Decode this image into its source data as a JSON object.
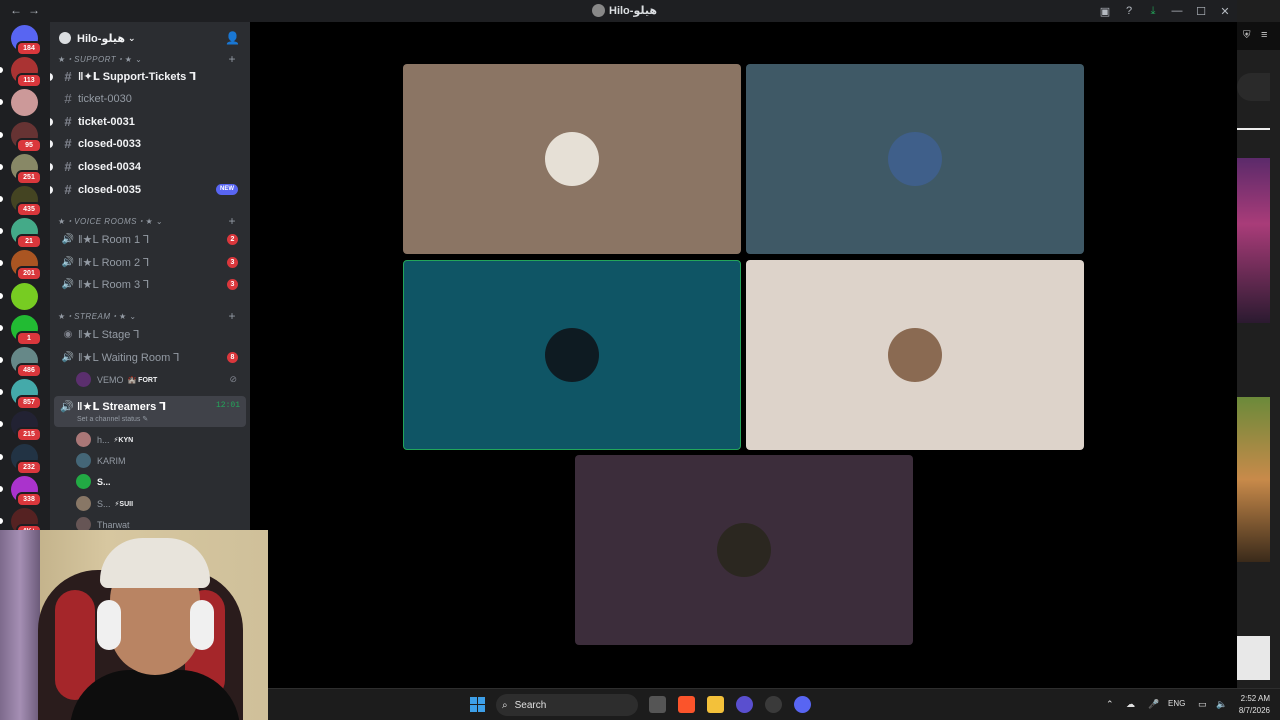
{
  "titlebar": {
    "title": "Hilo-هيلو"
  },
  "guilds": [
    {
      "badge": "184",
      "color": "#5865f2"
    },
    {
      "badge": "113",
      "color": "#a33"
    },
    {
      "badge": "",
      "color": "#c99"
    },
    {
      "badge": "95",
      "color": "#633"
    },
    {
      "badge": "251",
      "color": "#886"
    },
    {
      "badge": "435",
      "color": "#442"
    },
    {
      "badge": "21",
      "color": "#4a8"
    },
    {
      "badge": "201",
      "color": "#a52"
    },
    {
      "badge": "",
      "color": "#7c2"
    },
    {
      "badge": "1",
      "color": "#2b3"
    },
    {
      "badge": "486",
      "color": "#688"
    },
    {
      "badge": "857",
      "color": "#4aa"
    },
    {
      "badge": "215",
      "color": "#223"
    },
    {
      "badge": "232",
      "color": "#234"
    },
    {
      "badge": "338",
      "color": "#a3c"
    },
    {
      "badge": "4K+",
      "color": "#522"
    }
  ],
  "server": {
    "name": "Hilo-هيلو"
  },
  "categories": {
    "support": "★・SUPPORT・★",
    "voice": "★・VOICE ROOMS・★",
    "stream": "★・STREAM・★"
  },
  "text_channels": [
    {
      "name": "‖✦Ⅼ Support-Tickets ⅂",
      "unread": true
    },
    {
      "name": "ticket-0030",
      "unread": false
    },
    {
      "name": "ticket-0031",
      "unread": true
    },
    {
      "name": "closed-0033",
      "unread": true
    },
    {
      "name": "closed-0034",
      "unread": true
    },
    {
      "name": "closed-0035",
      "unread": true,
      "new_label": "NEW"
    }
  ],
  "voice_channels": [
    {
      "name": "‖★Ⅼ Room 1 ⅂",
      "count": "2"
    },
    {
      "name": "‖★Ⅼ Room 2 ⅂",
      "count": "3"
    },
    {
      "name": "‖★Ⅼ Room 3 ⅂",
      "count": "3"
    }
  ],
  "stream_channels": {
    "stage": "‖★Ⅼ Stage ⅂",
    "waiting": "‖★Ⅼ Waiting Room ⅂",
    "waiting_count": "8",
    "waiting_user": "VEMO",
    "waiting_user_tag": "🏰 FORT",
    "streamers": "‖★Ⅼ Streamers ⅂",
    "streamers_status": "Set a channel status ✎",
    "streamers_time": "12:01"
  },
  "streamers_users": [
    {
      "name": "h...",
      "tag": "⚡KYN",
      "bold": false,
      "color": "#a77"
    },
    {
      "name": "KARIM",
      "tag": "",
      "bold": false,
      "color": "#467"
    },
    {
      "name": "S...",
      "tag": "",
      "bold": true,
      "color": "#2a4"
    },
    {
      "name": "S...",
      "tag": "⚡SUII",
      "bold": false,
      "color": "#876"
    },
    {
      "name": "Tharwat",
      "tag": "",
      "bold": false,
      "color": "#655"
    }
  ],
  "tiles": [
    {
      "bg": "#8b7564",
      "avatar": "#e6e0d6",
      "active": false
    },
    {
      "bg": "#3f5966",
      "avatar": "#3f5f8a",
      "active": false
    },
    {
      "bg": "#0f5565",
      "avatar": "#0e1b22",
      "active": true
    },
    {
      "bg": "#ddd3ca",
      "avatar": "#8a6a52",
      "active": false
    },
    {
      "bg": "#3c2d3b",
      "avatar": "#2b2720",
      "active": false
    }
  ],
  "taskbar": {
    "search_label": "Search",
    "lang": "ENG",
    "time": "2:52 AM",
    "date": "8/7/2026"
  }
}
